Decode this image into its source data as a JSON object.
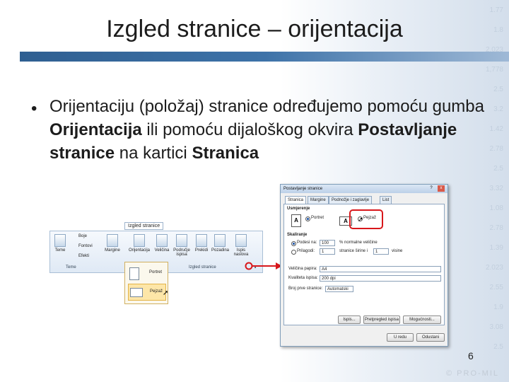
{
  "slide": {
    "title": "Izgled stranice – orijentacija",
    "bullet_symbol": "•",
    "body": {
      "p1": "Orijentaciju (položaj) stranice određujemo pomoću gumba ",
      "b1": "Orijentacija",
      "p2": " ili pomoću dijaloškog okvira ",
      "b2": "Postavljanje stranice",
      "p3": " na kartici ",
      "b3": "Stranica"
    },
    "page_number": "6",
    "copyright": "© PRO-MIL",
    "bg_numbers": [
      "1.77",
      "1.8",
      "2.023",
      "1,778",
      "2.5",
      "3.2",
      "1.42",
      "2.78",
      "2.5",
      "3.32",
      "1.08",
      "2.78",
      "1.39",
      "2.023",
      "2.55",
      "1.9",
      "3.08",
      "2.5"
    ]
  },
  "ribbon": {
    "tooltip": "Izgled stranice",
    "buttons": [
      "Teme",
      "Margine",
      "Orijentacija",
      "Veličina",
      "Područje ispisa",
      "Prekidi",
      "Pozadina",
      "Ispis naslova"
    ],
    "theme_small": [
      "Boje",
      "Fontovi",
      "Efekti"
    ],
    "group_theme_label": "Teme",
    "group_page_label": "Izgled stranice",
    "launcher_glyph": "↘",
    "dropdown": {
      "portrait": "Portret",
      "landscape": "Pejzaž"
    }
  },
  "dialog": {
    "title": "Postavljanje stranice",
    "help_glyph": "?",
    "close_glyph": "x",
    "tabs": [
      "Stranica",
      "Margine",
      "Podnožje i zaglavlje",
      "List"
    ],
    "orientation_label": "Usmjerenje",
    "portrait_label": "Portret",
    "landscape_label": "Pejzaž",
    "scaling_label": "Skaliranje",
    "adjust_label": "Podesi na:",
    "adjust_value": "100",
    "adjust_suffix": "% normalne veličine",
    "fit_label": "Prilagodi:",
    "fit_wide_value": "1",
    "fit_wide_suffix": "stranice širine i",
    "fit_tall_value": "1",
    "fit_tall_suffix": "visine",
    "paper_size_label": "Veličina papira:",
    "paper_size_value": "A4",
    "print_quality_label": "Kvaliteta ispisa:",
    "print_quality_value": "200 dpi",
    "first_page_label": "Broj prve stranice:",
    "first_page_value": "Automatski",
    "btn_print": "Ispis...",
    "btn_preview": "Pretpregled ispisa",
    "btn_options": "Mogućnosti...",
    "btn_ok": "U redu",
    "btn_cancel": "Odustani"
  },
  "colors": {
    "accent_bar": "#2f5f91",
    "highlight_red": "#d8171b"
  }
}
